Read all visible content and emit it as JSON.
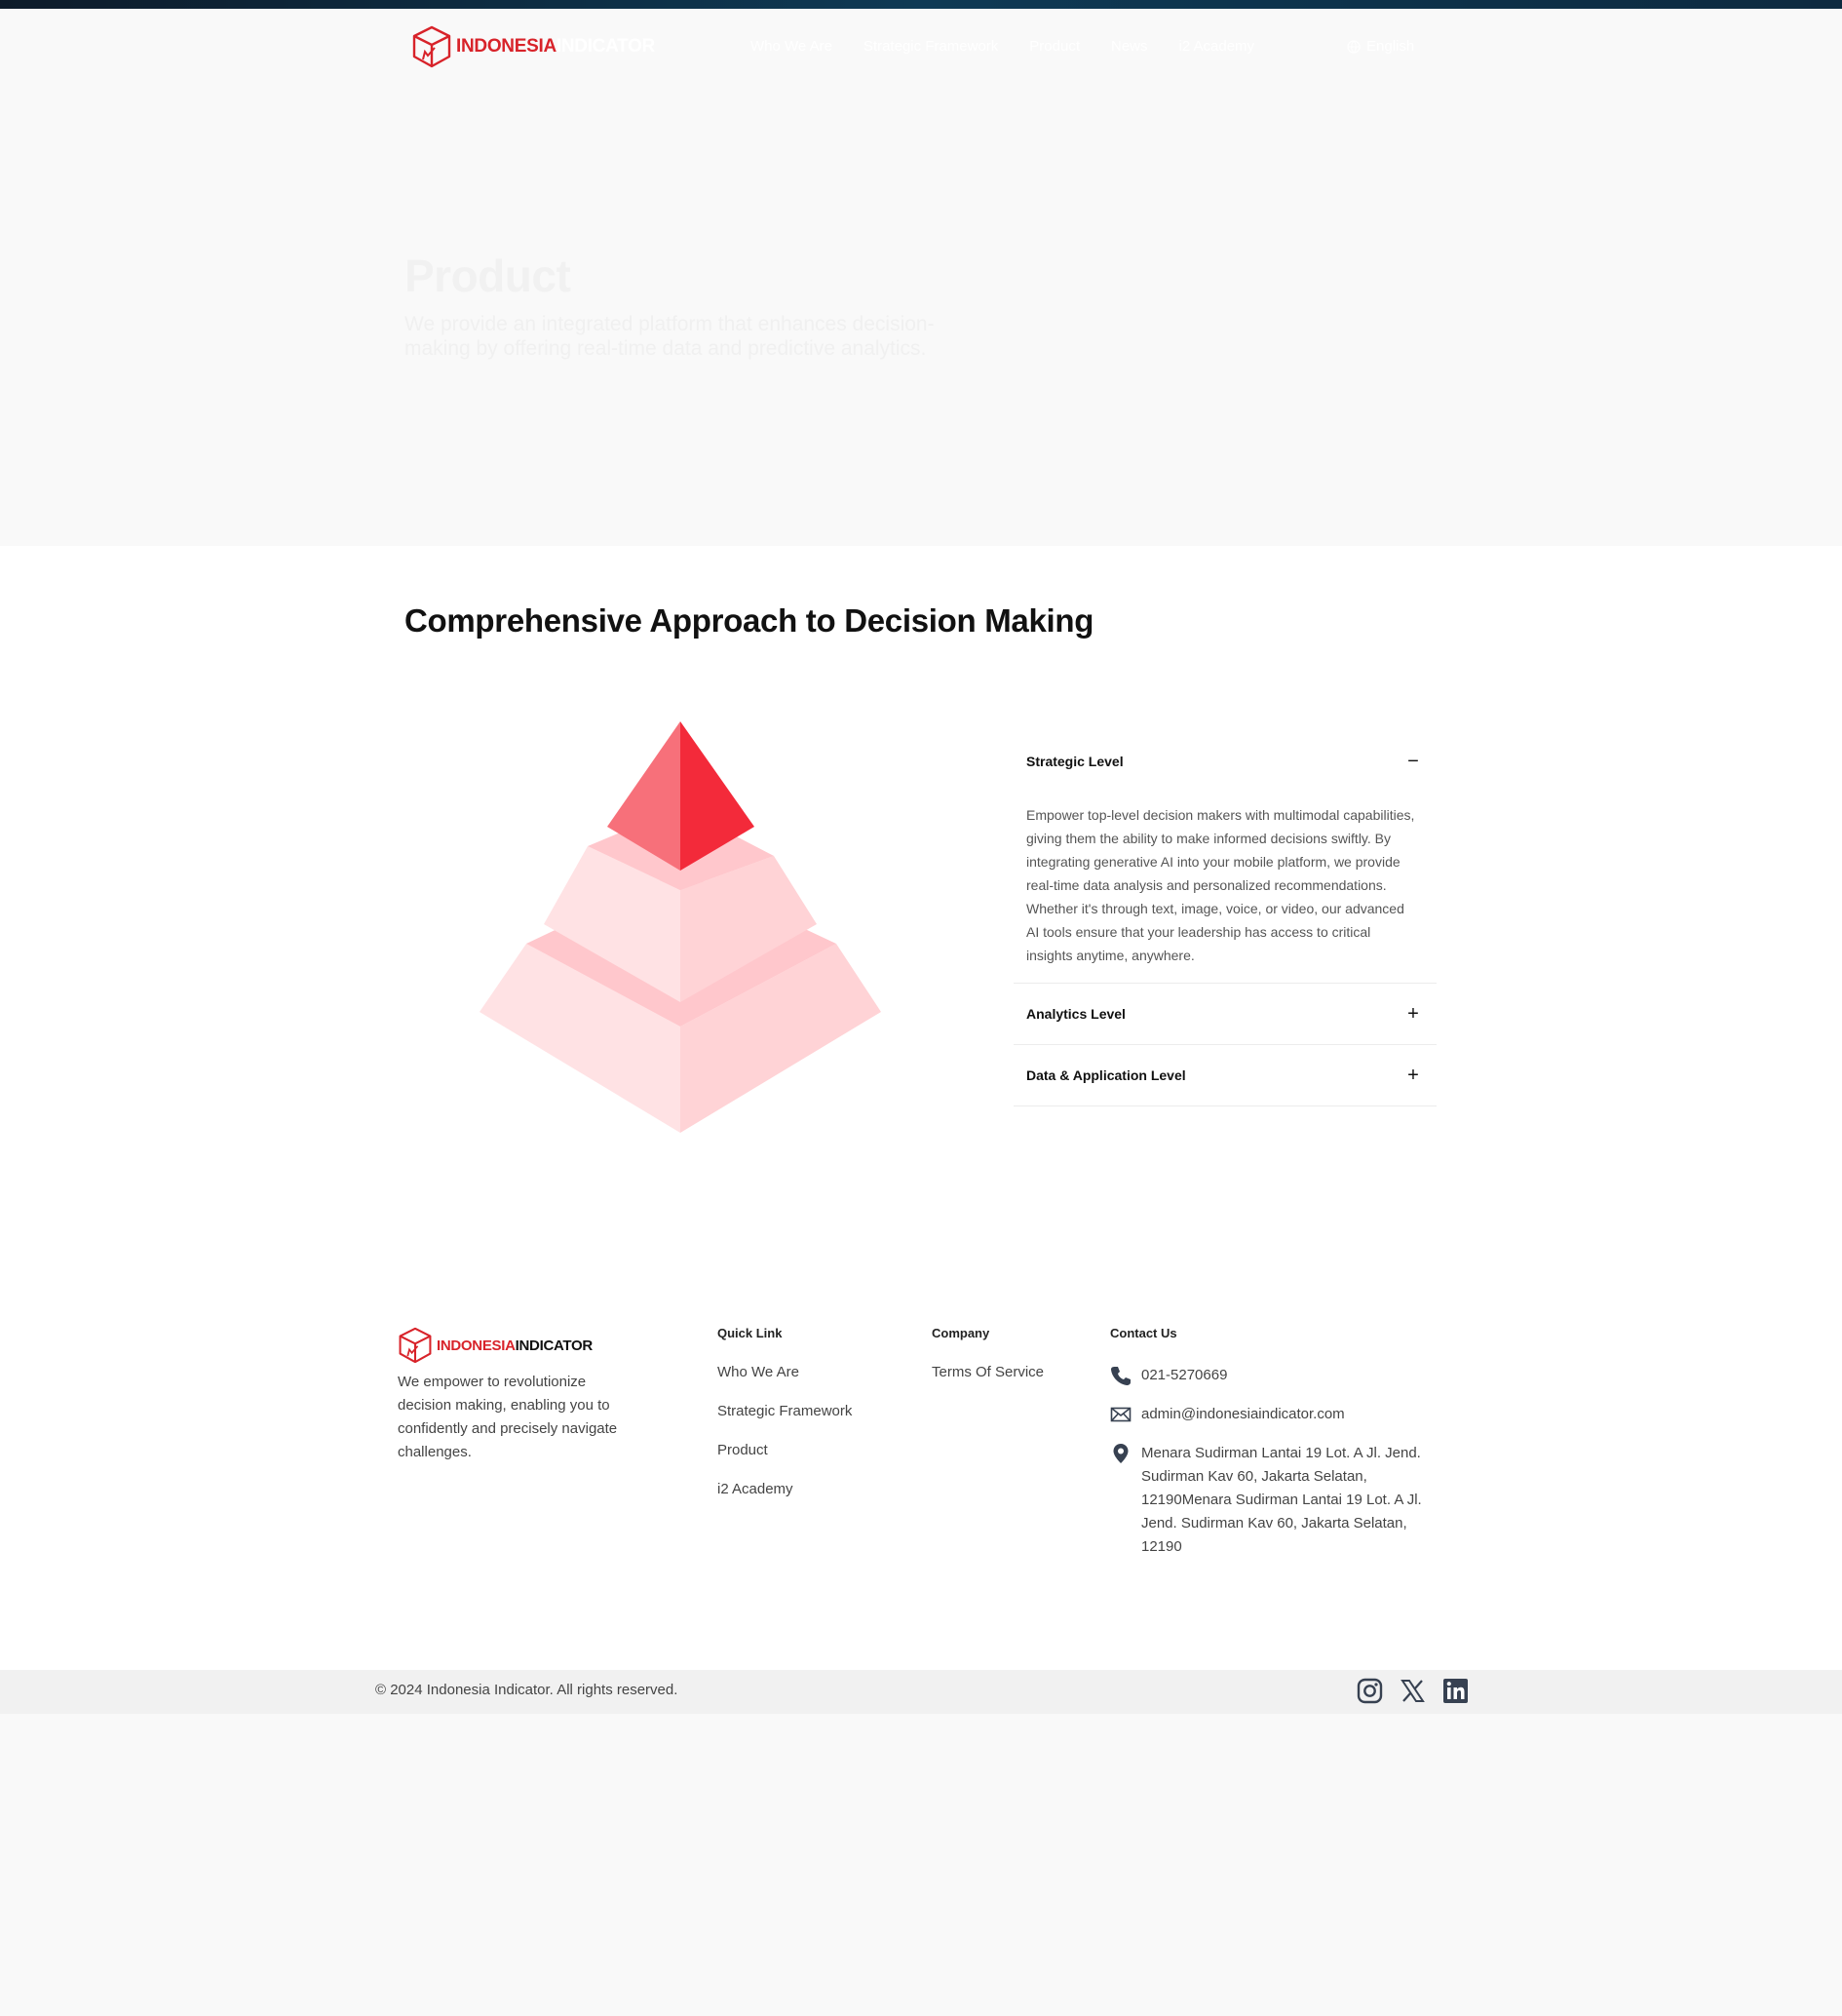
{
  "brand": {
    "name_part1": "INDONESIA",
    "name_part2": "INDICATOR",
    "red": "#d8232a"
  },
  "nav": {
    "links": [
      "Who We Are",
      "Strategic Framework",
      "Product",
      "News",
      "i2 Academy"
    ],
    "language": "English"
  },
  "hero": {
    "title": "Product",
    "subtitle": "We provide an integrated platform that enhances decision-making by offering real-time data and predictive analytics."
  },
  "section": {
    "title": "Comprehensive Approach to Decision Making"
  },
  "accordion": [
    {
      "title": "Strategic Level",
      "toggle": "−",
      "expanded": true,
      "body": "Empower top-level decision makers with multimodal capabilities, giving them the ability to make informed decisions swiftly. By integrating generative AI into your mobile platform, we provide real-time data analysis and personalized recommendations. Whether it's through text, image, voice, or video, our advanced AI tools ensure that your leadership has access to critical insights anytime, anywhere."
    },
    {
      "title": "Analytics Level",
      "toggle": "+",
      "expanded": false
    },
    {
      "title": "Data & Application Level",
      "toggle": "+",
      "expanded": false
    }
  ],
  "footer": {
    "tagline": "We empower to revolutionize decision making, enabling you to confidently and precisely navigate challenges.",
    "quick_link": {
      "heading": "Quick Link",
      "links": [
        "Who We Are",
        "Strategic Framework",
        "Product",
        "i2 Academy"
      ]
    },
    "company": {
      "heading": "Company",
      "links": [
        "Terms Of Service"
      ]
    },
    "contact": {
      "heading": "Contact Us",
      "phone": "021-5270669",
      "email": "admin@indonesiaindicator.com",
      "address": "Menara Sudirman Lantai 19 Lot. A Jl. Jend. Sudirman Kav 60, Jakarta Selatan, 12190Menara Sudirman Lantai 19 Lot. A Jl. Jend. Sudirman Kav 60, Jakarta Selatan, 12190"
    },
    "copyright": "© 2024 Indonesia Indicator. All rights reserved.",
    "socials": [
      "instagram-icon",
      "x-icon",
      "linkedin-icon"
    ]
  }
}
